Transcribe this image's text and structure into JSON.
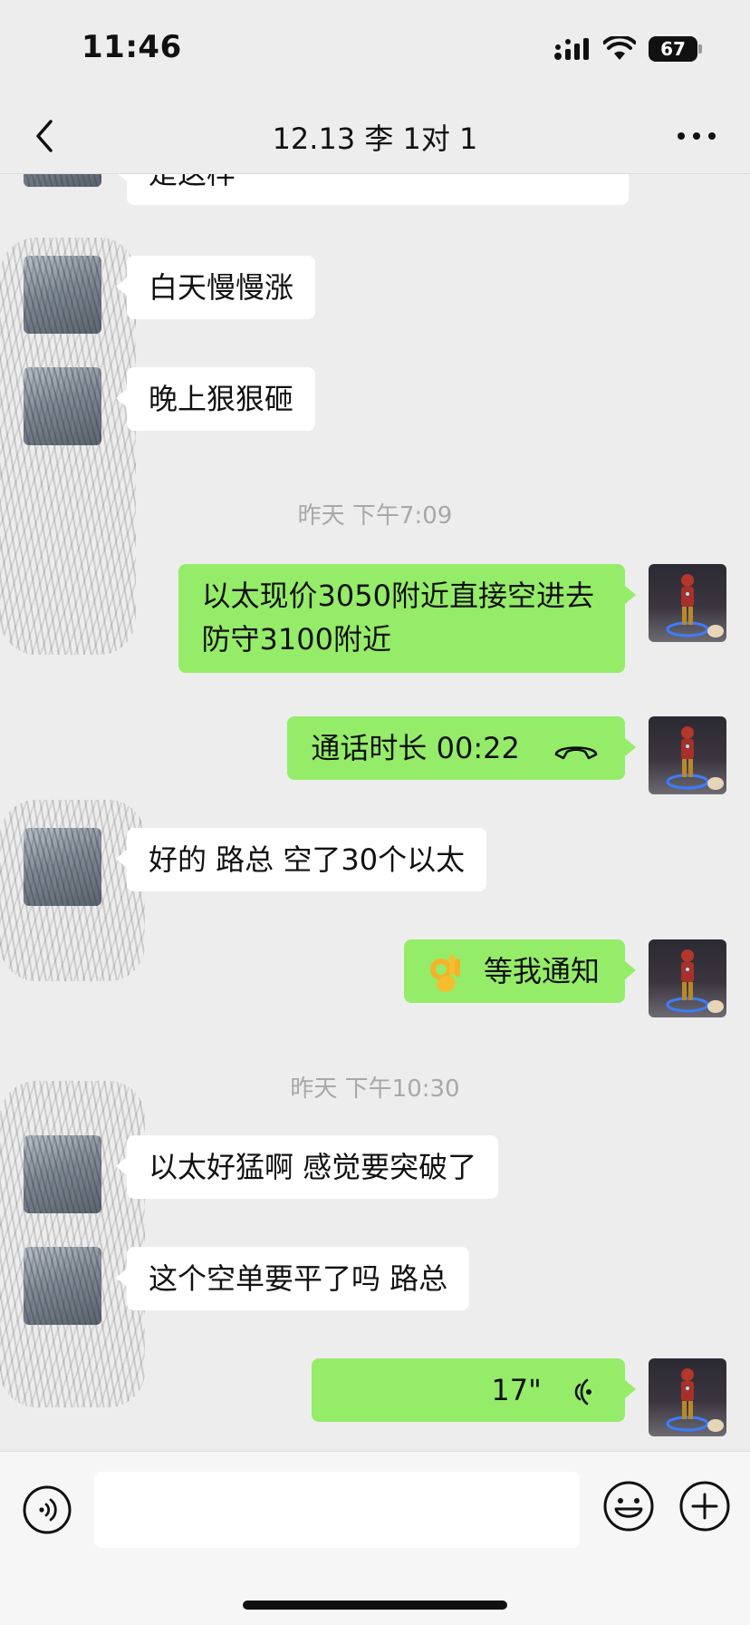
{
  "status_bar": {
    "time": "11:46",
    "battery": "67"
  },
  "header": {
    "title": "12.13 李 1对 1"
  },
  "messages": [
    {
      "text": "是这样"
    },
    {
      "text": "白天慢慢涨"
    },
    {
      "text": "晚上狠狠砸"
    },
    {
      "timestamp": "昨天 下午7:09"
    },
    {
      "line1": "以太现价3050附近直接空进去",
      "line2": "防守3100附近"
    },
    {
      "text": "通话时长 00:22"
    },
    {
      "text": "好的 路总 空了30个以太"
    },
    {
      "text": "等我通知"
    },
    {
      "timestamp": "昨天 下午10:30"
    },
    {
      "text": "以太好猛啊 感觉要突破了"
    },
    {
      "text": "这个空单要平了吗 路总"
    },
    {
      "duration": "17\""
    }
  ],
  "colors": {
    "outgoing_bubble": "#95ec69",
    "incoming_bubble": "#ffffff",
    "background": "#ededed"
  }
}
